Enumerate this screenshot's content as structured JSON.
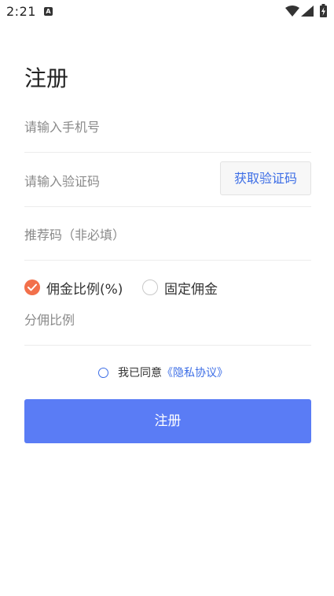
{
  "status_bar": {
    "time": "2:21",
    "notification_badge": "A",
    "icons": [
      "wifi-icon",
      "cellular-signal-icon",
      "battery-charging-icon"
    ]
  },
  "title": "注册",
  "form": {
    "phone_placeholder": "请输入手机号",
    "code_placeholder": "请输入验证码",
    "get_code_label": "获取验证码",
    "referral_placeholder": "推荐码（非必填）",
    "split_placeholder": "分佣比例"
  },
  "commission_type": {
    "options": [
      {
        "label": "佣金比例(%)",
        "checked": true
      },
      {
        "label": "固定佣金",
        "checked": false
      }
    ]
  },
  "agreement": {
    "text": "我已同意",
    "link": "《隐私协议》",
    "checked": false
  },
  "submit_label": "注册",
  "colors": {
    "accent": "#5a7cf5",
    "link": "#3d6ee6",
    "radio_checked": "#f2704b",
    "placeholder": "#8a8a8a",
    "divider": "#ececec"
  }
}
